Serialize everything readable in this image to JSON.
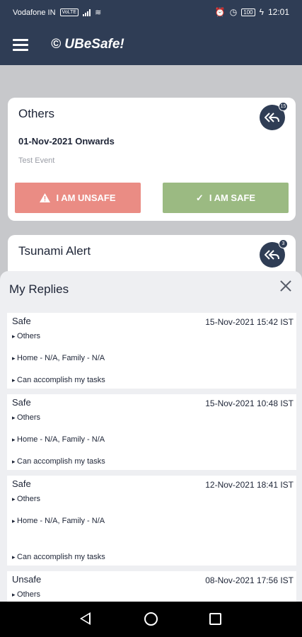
{
  "status_bar": {
    "carrier": "Vodafone IN",
    "network_badge": "VoLTE",
    "battery": "100",
    "time": "12:01"
  },
  "app_bar": {
    "title": "© UBeSafe!",
    "menu_icon": "hamburger-icon"
  },
  "events": [
    {
      "title": "Others",
      "date": "01-Nov-2021 Onwards",
      "description": "Test Event",
      "reply_badge": "15",
      "unsafe_label": "I AM UNSAFE",
      "safe_label": "I AM SAFE"
    },
    {
      "title": "Tsunami Alert",
      "reply_badge": "3"
    }
  ],
  "replies_sheet": {
    "title": "My Replies",
    "items": [
      {
        "status": "Safe",
        "timestamp": "15-Nov-2021 15:42 IST",
        "event": "Others",
        "location": "Home - N/A, Family - N/A",
        "note": "Can accomplish my tasks"
      },
      {
        "status": "Safe",
        "timestamp": "15-Nov-2021 10:48 IST",
        "event": "Others",
        "location": "Home - N/A, Family - N/A",
        "note": "Can accomplish my tasks"
      },
      {
        "status": "Safe",
        "timestamp": "12-Nov-2021 18:41 IST",
        "event": "Others",
        "location": "Home - N/A, Family - N/A",
        "note": "Can accomplish my tasks"
      },
      {
        "status": "Unsafe",
        "timestamp": "08-Nov-2021 17:56 IST",
        "event": "Others"
      }
    ]
  },
  "colors": {
    "primary": "#2f3d55",
    "unsafe": "#ea8c84",
    "safe": "#9bba82"
  }
}
